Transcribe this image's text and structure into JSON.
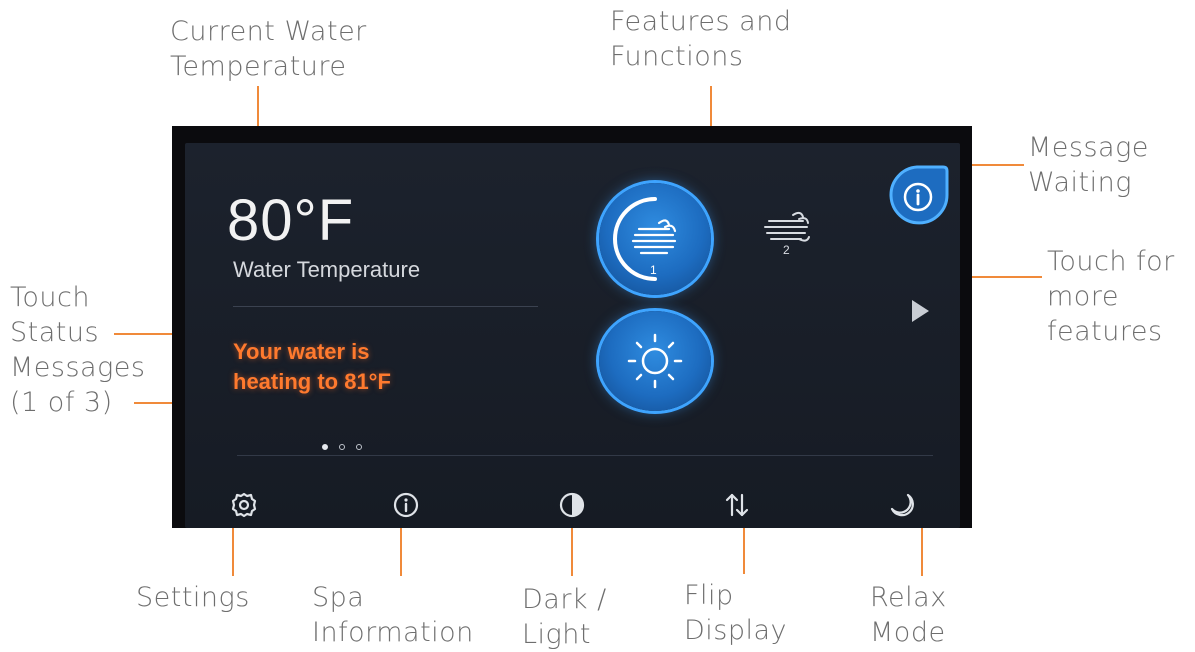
{
  "callouts": {
    "current_water_temperature": [
      "Current Water",
      "Temperature"
    ],
    "features_and_functions": [
      "Features and",
      "Functions"
    ],
    "message_waiting": [
      "Message",
      "Waiting"
    ],
    "touch_for_more_features": [
      "Touch for",
      "more",
      "features"
    ],
    "touch_status_messages": [
      "Touch",
      "Status",
      "Messages",
      "(1 of 3)"
    ],
    "settings": [
      "Settings"
    ],
    "spa_information": [
      "Spa",
      "Information"
    ],
    "dark_light": [
      "Dark /",
      "Light"
    ],
    "flip_display": [
      "Flip",
      "Display"
    ],
    "relax_mode": [
      "Relax",
      "Mode"
    ]
  },
  "screen": {
    "temperature": "80°F",
    "temperature_label": "Water Temperature",
    "status_message": [
      "Your water is",
      "heating to 81°F"
    ],
    "status_pages": {
      "current": 1,
      "total": 3
    },
    "features": [
      {
        "icon": "jets-1-icon",
        "label": "1",
        "active": true
      },
      {
        "icon": "jets-2-icon",
        "label": "2",
        "active": false
      },
      {
        "icon": "light-icon",
        "active": true
      }
    ],
    "message_icon": "info-icon",
    "more_icon": "play-icon",
    "toolbar": [
      {
        "icon": "gear-icon",
        "name": "Settings"
      },
      {
        "icon": "info-icon",
        "name": "Spa Information"
      },
      {
        "icon": "contrast-icon",
        "name": "Dark / Light"
      },
      {
        "icon": "flip-icon",
        "name": "Flip Display"
      },
      {
        "icon": "moon-icon",
        "name": "Relax Mode"
      }
    ]
  },
  "colors": {
    "accent_orange": "#f08a3a",
    "status_orange": "#ff7a2e",
    "button_blue": "#1d6cc0",
    "button_ring": "#3ea4ff",
    "screen_bg": "#1a1f29"
  }
}
